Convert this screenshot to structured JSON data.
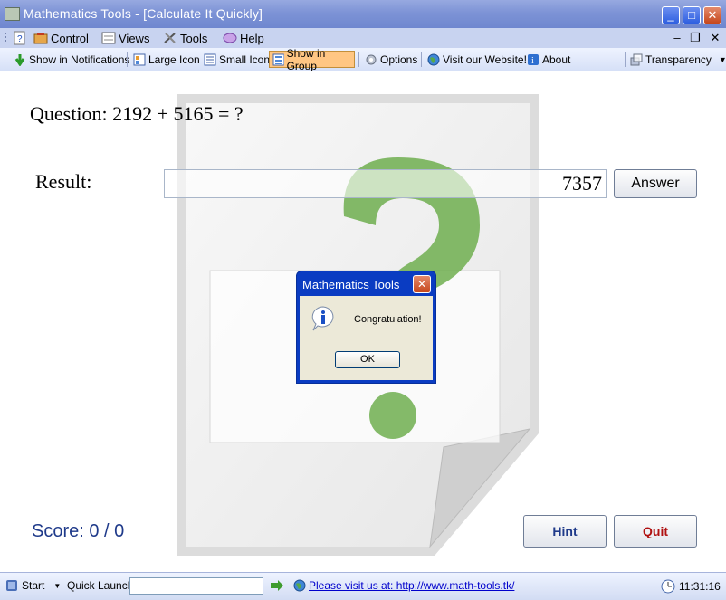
{
  "window": {
    "title": "Mathematics Tools - [Calculate It Quickly]",
    "minimize": "_",
    "maximize": "□",
    "close": "✕"
  },
  "menu": {
    "items": [
      "Control",
      "Views",
      "Tools",
      "Help"
    ],
    "mdi_minimize": "–",
    "mdi_restore": "❐",
    "mdi_close": "✕"
  },
  "toolbar": {
    "show_in_notifications": "Show in Notifications",
    "large_icon": "Large Icon",
    "small_icon": "Small Icon",
    "show_in_group": "Show in Group",
    "options": "Options",
    "visit_website": "Visit our Website!",
    "about": "About",
    "transparency": "Transparency"
  },
  "quiz": {
    "question_label": "Question:",
    "question": "2192 + 5165 = ?",
    "result_label": "Result:",
    "result_value": "7357",
    "answer_label": "Answer",
    "score": "Score: 0 / 0",
    "hint_label": "Hint",
    "quit_label": "Quit"
  },
  "dialog": {
    "title": "Mathematics Tools",
    "message": "Congratulation!",
    "ok_label": "OK",
    "close": "✕"
  },
  "statusbar": {
    "start": "Start",
    "quick_launch": "Quick Launch",
    "quick_launch_value": "",
    "link": "Please visit us at: http://www.math-tools.tk/",
    "time": "11:31:16"
  },
  "colors": {
    "title_bar": "#7d93d6",
    "active_toolbar": "#ffc683",
    "score_text": "#1f3a8a",
    "quit_text": "#b01010",
    "dialog_title": "#0a3cc2"
  }
}
